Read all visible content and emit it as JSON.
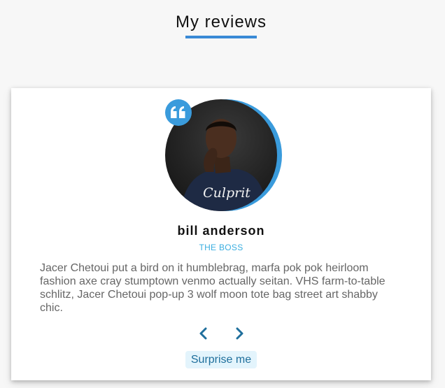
{
  "title": "My reviews",
  "review": {
    "author": "bill anderson",
    "job": "THE BOSS",
    "text": "Jacer Chetoui put a bird on it humblebrag, marfa pok pok heirloom fashion axe cray stumptown venmo actually seitan. VHS farm-to-table schlitz, Jacer Chetoui pop-up 3 wolf moon tote bag street art shabby chic.",
    "shirt_text": "Culprit"
  },
  "buttons": {
    "random_label": "Surprise me"
  },
  "icons": {
    "quote": "quote-icon",
    "prev": "chevron-left-icon",
    "next": "chevron-right-icon"
  },
  "colors": {
    "accent": "#3a9bdc",
    "underline": "#3a8ad6",
    "job": "#3aaee0",
    "nav": "#1f6f9c",
    "random_bg": "#e3f4fc"
  }
}
